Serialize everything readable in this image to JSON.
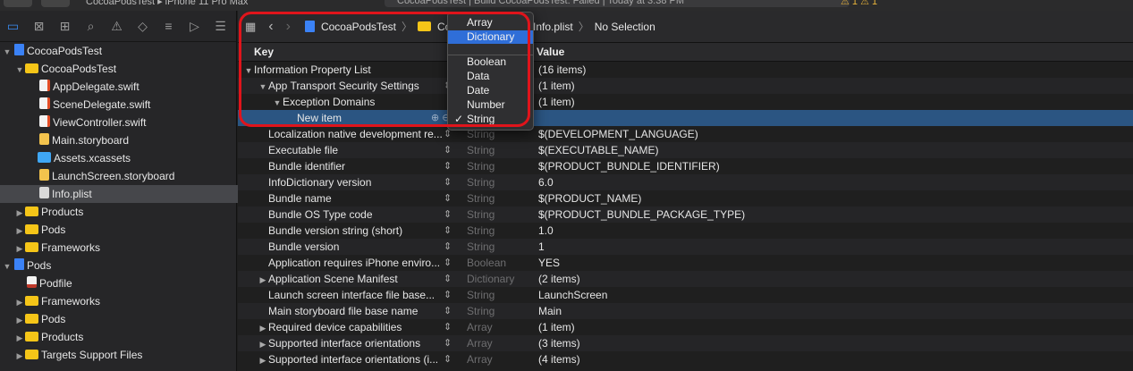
{
  "toolbar": {
    "scheme": "CocoaPodsTest ▸ iPhone 11 Pro Max",
    "status": "CocoaPodsTest | Build CocoaPodsTest: Failed | Today at 3:38 PM",
    "warning": "⚠ 1   ⚠ 1"
  },
  "navigator": {
    "icons": [
      "folder-icon",
      "source-control-icon",
      "symbol-icon",
      "find-icon",
      "issue-icon",
      "test-icon",
      "debug-icon",
      "breakpoint-icon",
      "report-icon"
    ],
    "rows": [
      {
        "label": "CocoaPodsTest",
        "kind": "project",
        "expanded": true,
        "indent": 0
      },
      {
        "label": "CocoaPodsTest",
        "kind": "folder",
        "expanded": true,
        "indent": 1
      },
      {
        "label": "AppDelegate.swift",
        "kind": "swift",
        "indent": 2
      },
      {
        "label": "SceneDelegate.swift",
        "kind": "swift",
        "indent": 2
      },
      {
        "label": "ViewController.swift",
        "kind": "swift",
        "indent": 2
      },
      {
        "label": "Main.storyboard",
        "kind": "story",
        "indent": 2
      },
      {
        "label": "Assets.xcassets",
        "kind": "assets",
        "indent": 2
      },
      {
        "label": "LaunchScreen.storyboard",
        "kind": "story",
        "indent": 2
      },
      {
        "label": "Info.plist",
        "kind": "plist",
        "indent": 2,
        "selected": true
      },
      {
        "label": "Products",
        "kind": "folder",
        "expanded": false,
        "indent": 1
      },
      {
        "label": "Pods",
        "kind": "folder",
        "expanded": false,
        "indent": 1
      },
      {
        "label": "Frameworks",
        "kind": "folder",
        "expanded": false,
        "indent": 1
      },
      {
        "label": "Pods",
        "kind": "project",
        "expanded": true,
        "indent": 0
      },
      {
        "label": "Podfile",
        "kind": "ruby",
        "indent": 1
      },
      {
        "label": "Frameworks",
        "kind": "folder",
        "expanded": false,
        "indent": 1
      },
      {
        "label": "Pods",
        "kind": "folder",
        "expanded": false,
        "indent": 1
      },
      {
        "label": "Products",
        "kind": "folder",
        "expanded": false,
        "indent": 1
      },
      {
        "label": "Targets Support Files",
        "kind": "folder",
        "expanded": false,
        "indent": 1
      }
    ]
  },
  "jumpbar": {
    "project": "CocoaPodsTest",
    "folder": "Cocoa",
    "file": "Info.plist",
    "selection": "No Selection"
  },
  "table": {
    "key_header": "Key",
    "value_header": "Value",
    "rows": [
      {
        "key": "Information Property List",
        "indent": 0,
        "disclosure": "open",
        "type": "",
        "value": "(16 items)"
      },
      {
        "key": "App Transport Security Settings",
        "indent": 1,
        "disclosure": "open",
        "type": "",
        "value": "(1 item)",
        "stepper": true
      },
      {
        "key": "Exception Domains",
        "indent": 2,
        "disclosure": "open",
        "type": "",
        "value": "(1 item)"
      },
      {
        "key": "New item",
        "indent": 3,
        "disclosure": "",
        "type": "",
        "value": "",
        "selected": true,
        "add_remove": "⊕ ⊖"
      },
      {
        "key": "Localization native development re...",
        "indent": 1,
        "disclosure": "",
        "type": "String",
        "value": "$(DEVELOPMENT_LANGUAGE)",
        "stepper": true
      },
      {
        "key": "Executable file",
        "indent": 1,
        "disclosure": "",
        "type": "String",
        "value": "$(EXECUTABLE_NAME)",
        "stepper": true
      },
      {
        "key": "Bundle identifier",
        "indent": 1,
        "disclosure": "",
        "type": "String",
        "value": "$(PRODUCT_BUNDLE_IDENTIFIER)",
        "stepper": true
      },
      {
        "key": "InfoDictionary version",
        "indent": 1,
        "disclosure": "",
        "type": "String",
        "value": "6.0",
        "stepper": true
      },
      {
        "key": "Bundle name",
        "indent": 1,
        "disclosure": "",
        "type": "String",
        "value": "$(PRODUCT_NAME)",
        "stepper": true
      },
      {
        "key": "Bundle OS Type code",
        "indent": 1,
        "disclosure": "",
        "type": "String",
        "value": "$(PRODUCT_BUNDLE_PACKAGE_TYPE)",
        "stepper": true
      },
      {
        "key": "Bundle version string (short)",
        "indent": 1,
        "disclosure": "",
        "type": "String",
        "value": "1.0",
        "stepper": true
      },
      {
        "key": "Bundle version",
        "indent": 1,
        "disclosure": "",
        "type": "String",
        "value": "1",
        "stepper": true
      },
      {
        "key": "Application requires iPhone enviro...",
        "indent": 1,
        "disclosure": "",
        "type": "Boolean",
        "value": "YES",
        "stepper": true
      },
      {
        "key": "Application Scene Manifest",
        "indent": 1,
        "disclosure": "closed",
        "type": "Dictionary",
        "value": "(2 items)",
        "stepper": true
      },
      {
        "key": "Launch screen interface file base...",
        "indent": 1,
        "disclosure": "",
        "type": "String",
        "value": "LaunchScreen",
        "stepper": true
      },
      {
        "key": "Main storyboard file base name",
        "indent": 1,
        "disclosure": "",
        "type": "String",
        "value": "Main",
        "stepper": true
      },
      {
        "key": "Required device capabilities",
        "indent": 1,
        "disclosure": "closed",
        "type": "Array",
        "value": "(1 item)",
        "stepper": true
      },
      {
        "key": "Supported interface orientations",
        "indent": 1,
        "disclosure": "closed",
        "type": "Array",
        "value": "(3 items)",
        "stepper": true
      },
      {
        "key": "Supported interface orientations (i...",
        "indent": 1,
        "disclosure": "closed",
        "type": "Array",
        "value": "(4 items)",
        "stepper": true
      }
    ]
  },
  "type_popup": {
    "options": [
      "Array",
      "Dictionary",
      "Boolean",
      "Data",
      "Date",
      "Number",
      "String"
    ],
    "highlighted": "Dictionary",
    "checked": "String"
  },
  "colors": {
    "accent": "#2f6ed8",
    "highlight_ring": "#e0141b",
    "selection": "#2b5582"
  }
}
